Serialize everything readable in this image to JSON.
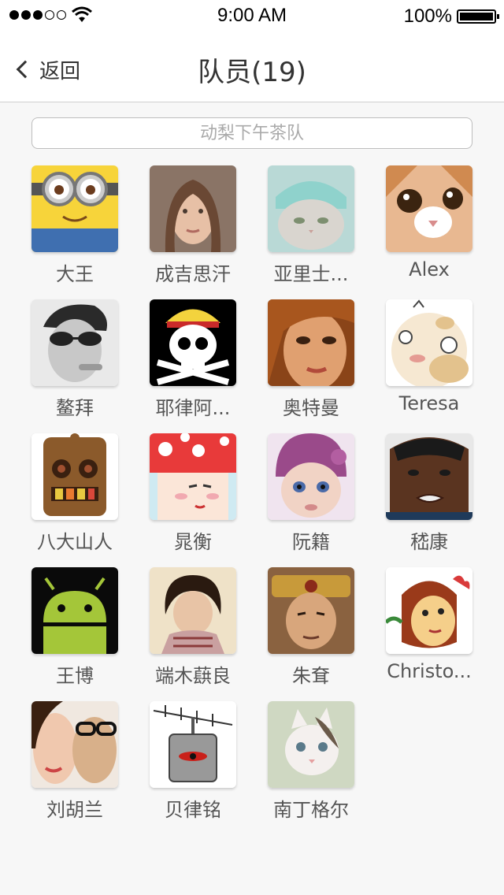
{
  "status_bar": {
    "time": "9:00 AM",
    "battery": "100%",
    "signal_bars": 3,
    "signal_total": 5
  },
  "nav": {
    "back_label": "返回",
    "title": "队员(19)"
  },
  "search": {
    "placeholder": "动梨下午茶队"
  },
  "members": [
    {
      "name": "大王",
      "avatar": "minion-avatar"
    },
    {
      "name": "成吉思汗",
      "avatar": "woman-portrait-avatar"
    },
    {
      "name": "亚里士...",
      "avatar": "cat-towel-avatar"
    },
    {
      "name": "Alex",
      "avatar": "kitten-closeup-avatar"
    },
    {
      "name": "鳌拜",
      "avatar": "man-sunglasses-avatar"
    },
    {
      "name": "耶律阿...",
      "avatar": "pirate-skull-avatar"
    },
    {
      "name": "奥特曼",
      "avatar": "girl-closeup-avatar"
    },
    {
      "name": "Teresa",
      "avatar": "cartoon-egg-face-avatar"
    },
    {
      "name": "八大山人",
      "avatar": "cartoon-robot-avatar"
    },
    {
      "name": "晁衡",
      "avatar": "mushroom-character-avatar"
    },
    {
      "name": "阮籍",
      "avatar": "baby-hat-avatar"
    },
    {
      "name": "嵇康",
      "avatar": "man-face-avatar"
    },
    {
      "name": "王博",
      "avatar": "android-logo-avatar"
    },
    {
      "name": "端木蕻良",
      "avatar": "girl-short-hair-avatar"
    },
    {
      "name": "朱耷",
      "avatar": "qing-official-avatar"
    },
    {
      "name": "Christo...",
      "avatar": "cartoon-monkey-avatar"
    },
    {
      "name": "刘胡兰",
      "avatar": "couple-photo-avatar"
    },
    {
      "name": "贝律铭",
      "avatar": "antenna-robot-avatar"
    },
    {
      "name": "南丁格尔",
      "avatar": "white-kitten-avatar"
    }
  ]
}
